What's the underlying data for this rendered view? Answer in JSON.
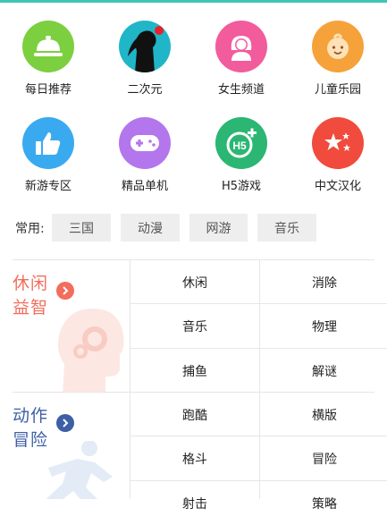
{
  "categories": [
    {
      "label": "每日推荐",
      "icon": "food-cover-icon",
      "color": "#7ccf3f"
    },
    {
      "label": "二次元",
      "icon": "anime-girl-icon",
      "color": "#20b6c7"
    },
    {
      "label": "女生频道",
      "icon": "girl-avatar-icon",
      "color": "#f25b9c"
    },
    {
      "label": "儿童乐园",
      "icon": "child-face-icon",
      "color": "#f6a23a"
    },
    {
      "label": "新游专区",
      "icon": "thumbs-up-icon",
      "color": "#3aaaf0"
    },
    {
      "label": "精品单机",
      "icon": "gamepad-icon",
      "color": "#b476ec"
    },
    {
      "label": "H5游戏",
      "icon": "h5-plus-icon",
      "color": "#2bb673"
    },
    {
      "label": "中文汉化",
      "icon": "stars-icon",
      "color": "#f04b3d"
    }
  ],
  "common": {
    "label": "常用:",
    "tags": [
      "三国",
      "动漫",
      "网游",
      "音乐"
    ]
  },
  "sections": [
    {
      "title_line1": "休闲",
      "title_line2": "益智",
      "title_color": "#f26d5b",
      "arrow_color": "#f26d5b",
      "bg_icon": "head-gears-icon",
      "items": [
        "休闲",
        "消除",
        "音乐",
        "物理",
        "捕鱼",
        "解谜"
      ]
    },
    {
      "title_line1": "动作",
      "title_line2": "冒险",
      "title_color": "#3d5fa6",
      "arrow_color": "#3d5fa6",
      "bg_icon": "running-man-icon",
      "items": [
        "跑酷",
        "横版",
        "格斗",
        "冒险",
        "射击",
        "策略"
      ]
    }
  ]
}
